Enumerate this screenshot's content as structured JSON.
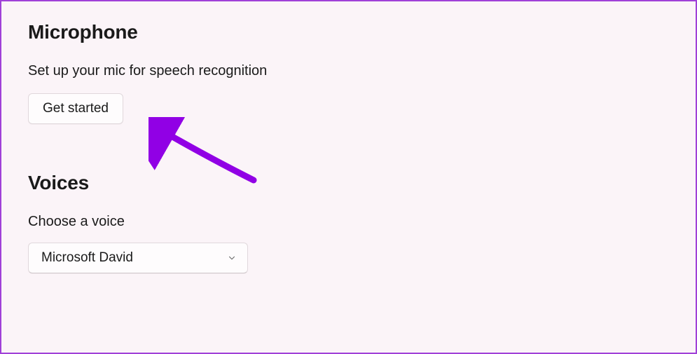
{
  "microphone": {
    "heading": "Microphone",
    "description": "Set up your mic for speech recognition",
    "button_label": "Get started"
  },
  "voices": {
    "heading": "Voices",
    "label": "Choose a voice",
    "selected": "Microsoft David"
  },
  "annotation": {
    "arrow_color": "#9100e5"
  }
}
